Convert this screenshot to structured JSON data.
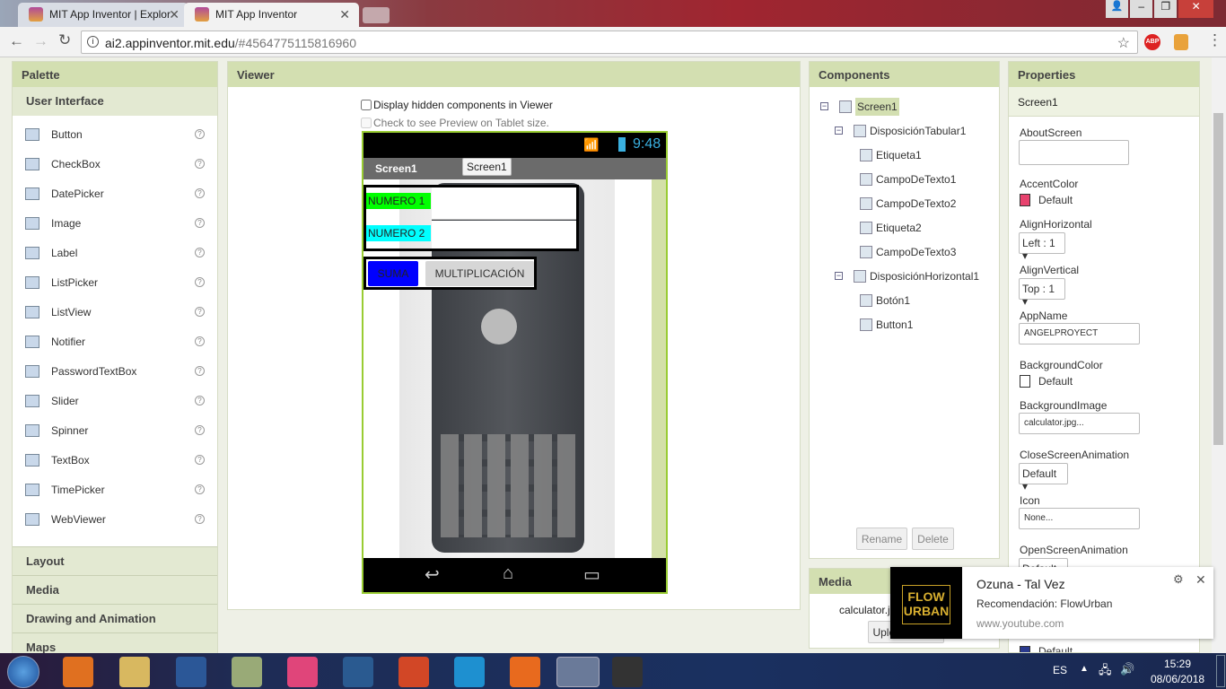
{
  "browser": {
    "tabs": [
      {
        "title": "MIT App Inventor | Explor"
      },
      {
        "title": "MIT App Inventor"
      }
    ],
    "url_host": "ai2.appinventor.mit.edu",
    "url_path": "/#4564775115816960"
  },
  "palette": {
    "title": "Palette",
    "category": "User Interface",
    "items": [
      "Button",
      "CheckBox",
      "DatePicker",
      "Image",
      "Label",
      "ListPicker",
      "ListView",
      "Notifier",
      "PasswordTextBox",
      "Slider",
      "Spinner",
      "TextBox",
      "TimePicker",
      "WebViewer"
    ],
    "help": "?",
    "categories": [
      "Layout",
      "Media",
      "Drawing and Animation",
      "Maps"
    ]
  },
  "viewer": {
    "title": "Viewer",
    "hidden_label": "Display hidden components in Viewer",
    "tablet_label": "Check to see Preview on Tablet size.",
    "phone": {
      "time": "9:48",
      "screen_title": "Screen1",
      "tooltip": "Screen1",
      "label1": "NUMERO 1",
      "label2": "NUMERO 2",
      "button1": "SUMA",
      "button2": "MULTIPLICACIÓN"
    }
  },
  "components": {
    "title": "Components",
    "tree": [
      {
        "name": "Screen1",
        "level": 0,
        "toggle": "−"
      },
      {
        "name": "DisposiciónTabular1",
        "level": 1,
        "toggle": "−"
      },
      {
        "name": "Etiqueta1",
        "level": 2
      },
      {
        "name": "CampoDeTexto1",
        "level": 2
      },
      {
        "name": "CampoDeTexto2",
        "level": 2
      },
      {
        "name": "Etiqueta2",
        "level": 2
      },
      {
        "name": "CampoDeTexto3",
        "level": 2
      },
      {
        "name": "DisposiciónHorizontal1",
        "level": 1,
        "toggle": "−"
      },
      {
        "name": "Botón1",
        "level": 2
      },
      {
        "name": "Button1",
        "level": 2
      }
    ],
    "rename": "Rename",
    "delete": "Delete"
  },
  "media": {
    "title": "Media",
    "file": "calculator.jpg",
    "upload": "Upload File ..."
  },
  "properties": {
    "title": "Properties",
    "component": "Screen1",
    "about_label": "AboutScreen",
    "accent_label": "AccentColor",
    "accent_value": "Default",
    "accent_color": "#e8426e",
    "alignh_label": "AlignHorizontal",
    "alignh_value": "Left : 1 ▾",
    "alignv_label": "AlignVertical",
    "alignv_value": "Top : 1 ▾",
    "appname_label": "AppName",
    "appname_value": "ANGELPROYECT",
    "bgcolor_label": "BackgroundColor",
    "bgcolor_value": "Default",
    "bgimage_label": "BackgroundImage",
    "bgimage_value": "calculator.jpg...",
    "closeanim_label": "CloseScreenAnimation",
    "closeanim_value": "Default ▾",
    "icon_label": "Icon",
    "icon_value": "None...",
    "openanim_label": "OpenScreenAnimation",
    "openanim_value": "Default",
    "last_value": "Default"
  },
  "notification": {
    "title": "Ozuna - Tal Vez",
    "subtitle": "Recomendación: FlowUrban",
    "source": "www.youtube.com",
    "logo_text": "FLOW URBAN"
  },
  "taskbar": {
    "lang": "ES",
    "time": "15:29",
    "date": "08/06/2018"
  }
}
